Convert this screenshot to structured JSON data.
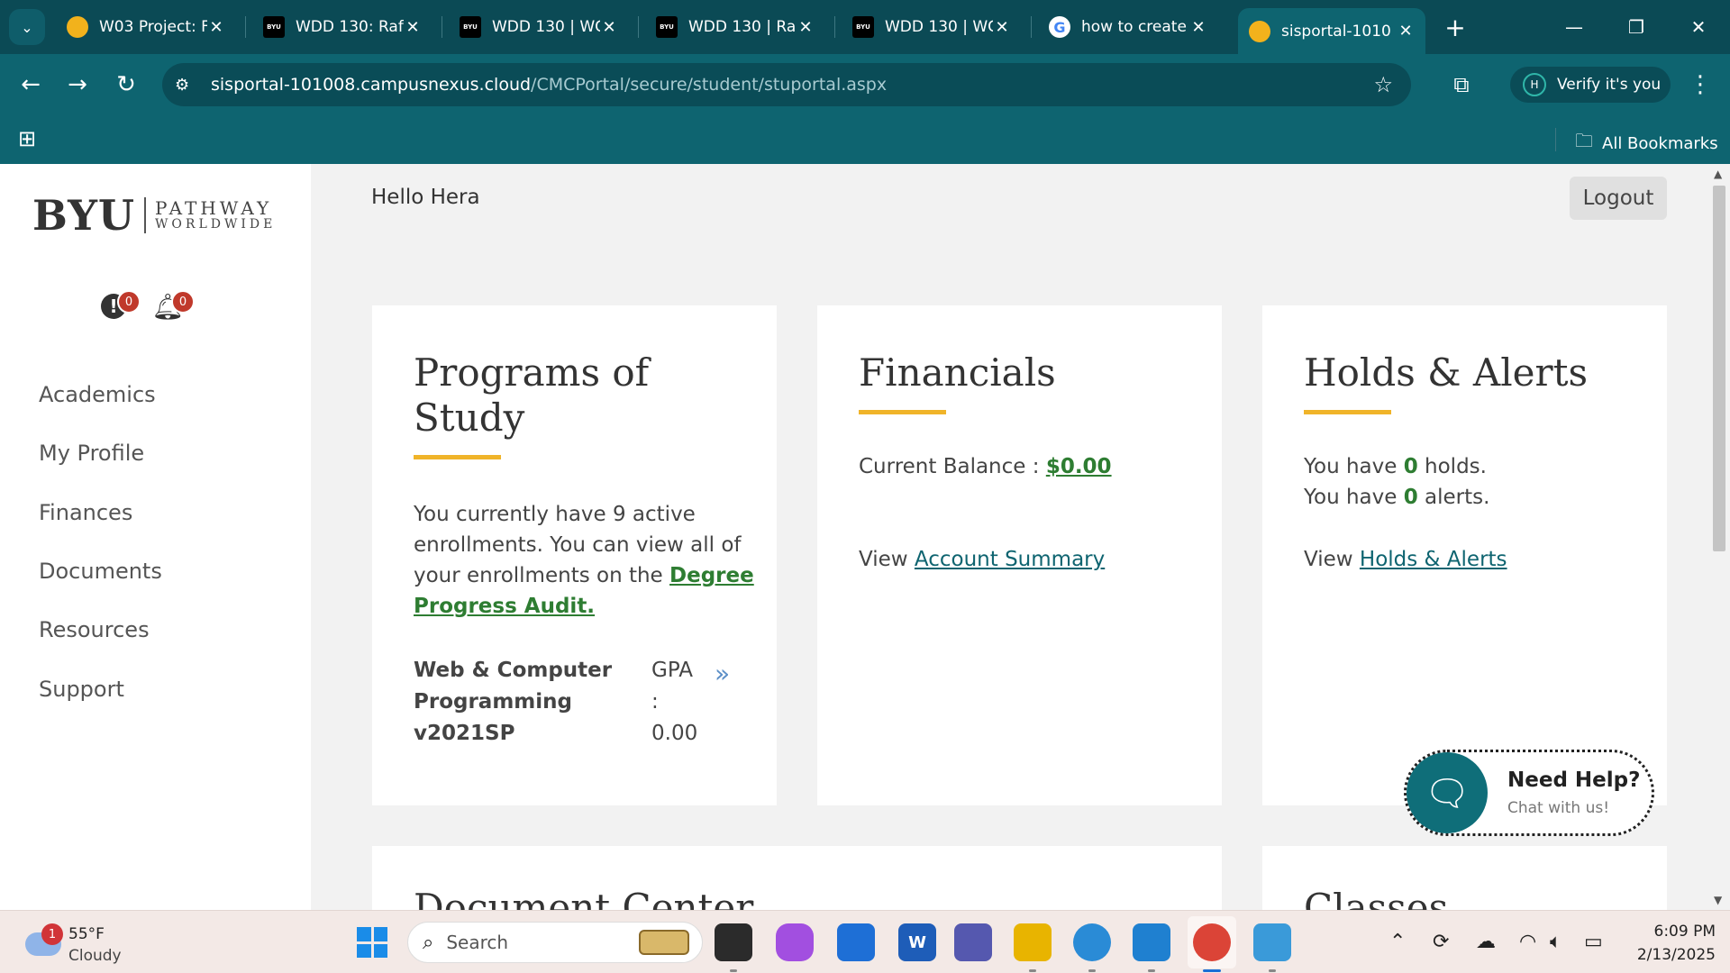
{
  "browser": {
    "tabs": [
      {
        "title": "W03 Project: F",
        "favicon": "pathway-logo-icon",
        "active": false
      },
      {
        "title": "WDD 130: Raf",
        "favicon": "byu-logo-icon",
        "active": false
      },
      {
        "title": "WDD 130 | WC",
        "favicon": "byu-logo-icon",
        "active": false
      },
      {
        "title": "WDD 130 | Ra",
        "favicon": "byu-logo-icon",
        "active": false
      },
      {
        "title": "WDD 130 | WC",
        "favicon": "byu-logo-icon",
        "active": false
      },
      {
        "title": "how to create",
        "favicon": "google-icon",
        "active": false
      },
      {
        "title": "sisportal-1010",
        "favicon": "pathway-logo-icon",
        "active": true
      }
    ],
    "url_host": "sisportal-101008.campusnexus.cloud",
    "url_path": "/CMCPortal/secure/student/stuportal.aspx",
    "profile_label": "Verify it's you",
    "profile_initial": "H",
    "all_bookmarks": "All Bookmarks",
    "favicon_byu_text": "BYU"
  },
  "sidebar": {
    "logo_main": "BYU",
    "logo_line1": "PATHWAY",
    "logo_line2": "WORLDWIDE",
    "alerts_count": "0",
    "notifications_count": "0",
    "nav": [
      "Academics",
      "My Profile",
      "Finances",
      "Documents",
      "Resources",
      "Support"
    ]
  },
  "header": {
    "greeting": "Hello Hera",
    "logout": "Logout"
  },
  "programs": {
    "title": "Programs of Study",
    "text": "You currently have 9 active enrollments. You can view all of your enrollments on the",
    "link": "Degree Progress Audit.",
    "program_name": "Web & Computer Programming v2021SP",
    "gpa_label": "GPA :",
    "gpa_value": "0.00"
  },
  "financials": {
    "title": "Financials",
    "balance_label": "Current Balance :",
    "balance_value": "$0.00",
    "view_label": "View",
    "view_link": "Account Summary"
  },
  "holds": {
    "title": "Holds & Alerts",
    "holds_pre": "You have",
    "holds_count": "0",
    "holds_post": "holds.",
    "alerts_pre": "You have",
    "alerts_count": "0",
    "alerts_post": "alerts.",
    "view_label": "View",
    "view_link": "Holds & Alerts"
  },
  "lower_cards": {
    "document_center": "Document Center",
    "classes": "Classes"
  },
  "chat": {
    "title": "Need Help?",
    "subtitle": "Chat with us!"
  },
  "taskbar": {
    "weather_temp": "55°F",
    "weather_cond": "Cloudy",
    "weather_badge": "1",
    "search_label": "Search",
    "word_letter": "W",
    "time": "6:09 PM",
    "date": "2/13/2025"
  },
  "colors": {
    "chrome_dark": "#0b4a55",
    "chrome": "#0e6470",
    "accent_yellow": "#f0b429",
    "link_green": "#2e7d32"
  }
}
